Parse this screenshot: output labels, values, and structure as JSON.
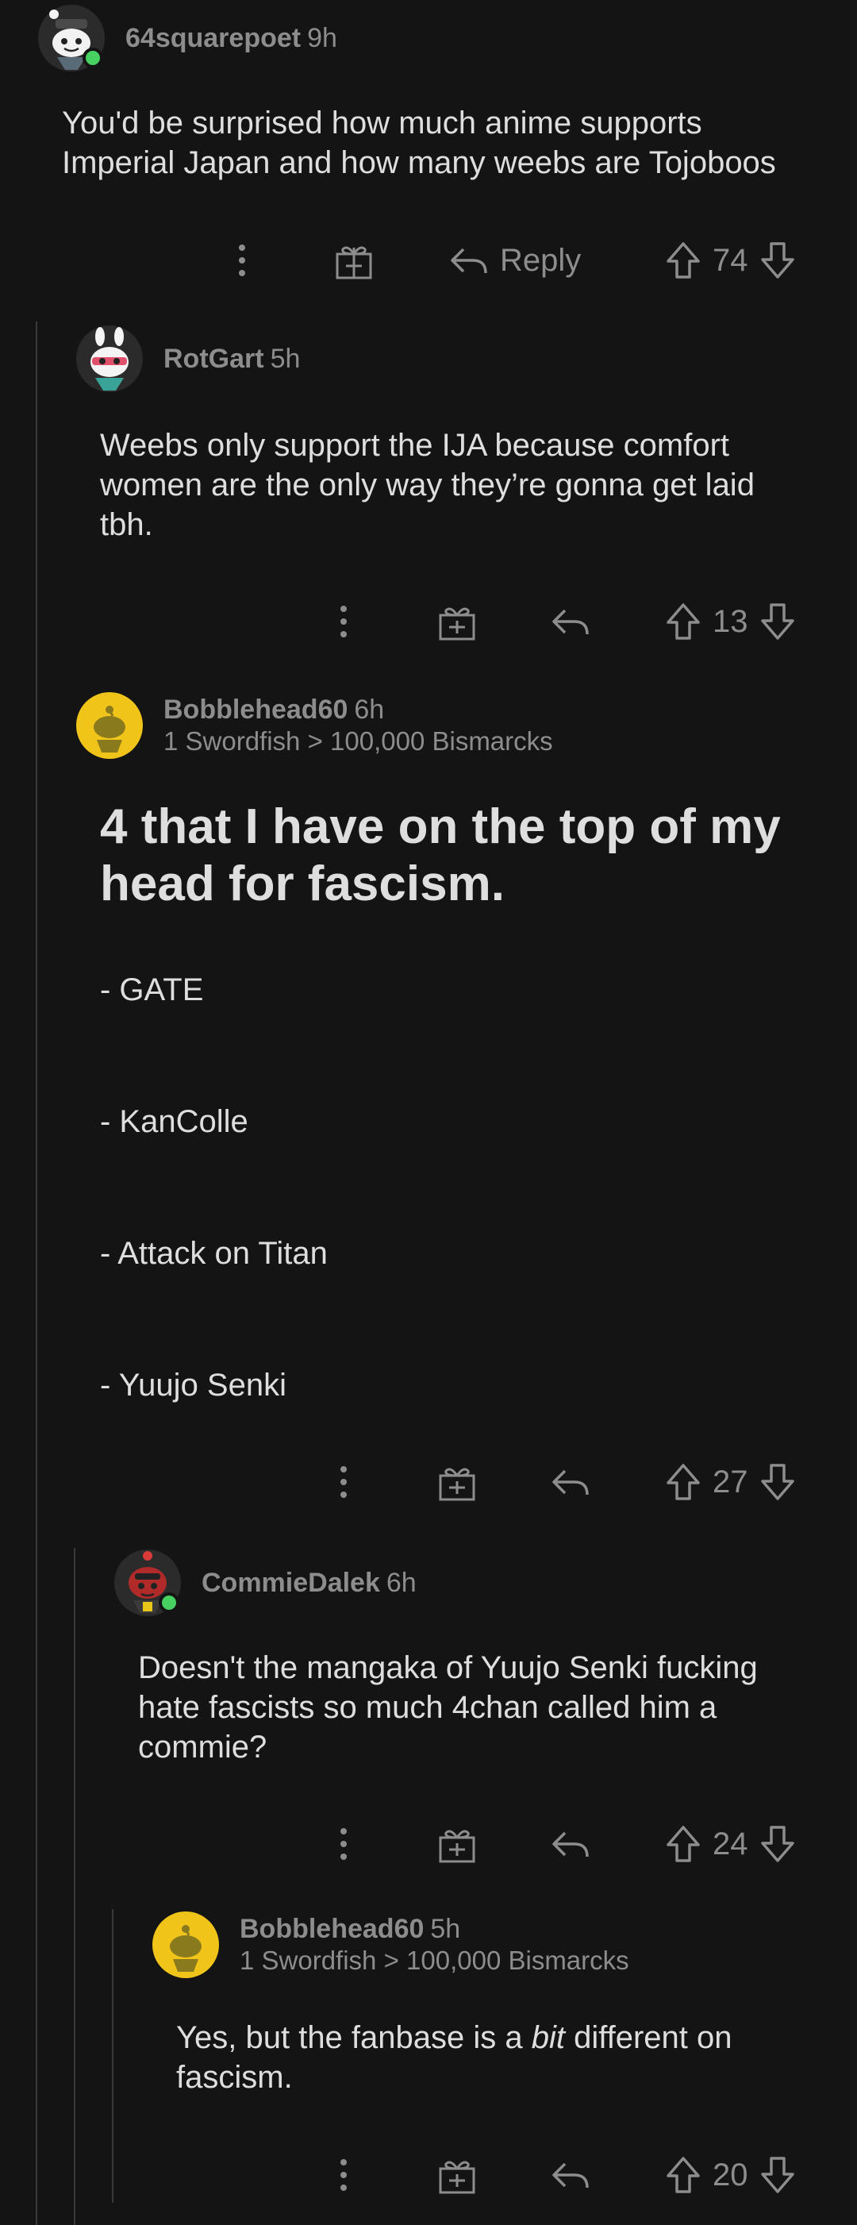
{
  "comments": [
    {
      "username": "64squarepoet",
      "time": "9h",
      "body": [
        "You'd be surprised how much anime supports",
        "Imperial Japan and how many weebs are Tojoboos"
      ],
      "reply_label": "Reply",
      "score": "74"
    },
    {
      "username": "RotGart",
      "time": "5h",
      "body": [
        "Weebs only support the IJA because comfort",
        "women are the only way they’re gonna get laid",
        "tbh."
      ],
      "score": "13"
    },
    {
      "username": "Bobblehead60",
      "time": "6h",
      "flair": "1 Swordfish > 100,000 Bismarcks",
      "heading": [
        "4 that I have on the top of my",
        "head for fascism."
      ],
      "list": [
        "- GATE",
        "- KanColle",
        "- Attack on Titan",
        "- Yuujo Senki"
      ],
      "score": "27"
    },
    {
      "username": "CommieDalek",
      "time": "6h",
      "body": [
        "Doesn't the mangaka of Yuujo Senki fucking",
        "hate fascists so much 4chan called him a",
        "commie?"
      ],
      "score": "24"
    },
    {
      "username": "Bobblehead60",
      "time": "5h",
      "flair": "1 Swordfish > 100,000 Bismarcks",
      "body_pre": "Yes, but the fanbase is a ",
      "body_em": "bit",
      "body_post": " different on",
      "body2": "fascism.",
      "score": "20"
    }
  ],
  "icons": {
    "more": "more-vertical-icon",
    "award": "award-gift-icon",
    "reply": "reply-arrow-icon",
    "upvote": "upvote-arrow-icon",
    "downvote": "downvote-arrow-icon"
  },
  "colors": {
    "background": "#141414",
    "text": "#dedede",
    "muted": "#8d8d8d",
    "online": "#46d160",
    "thread_line": "#3a3a3a"
  }
}
